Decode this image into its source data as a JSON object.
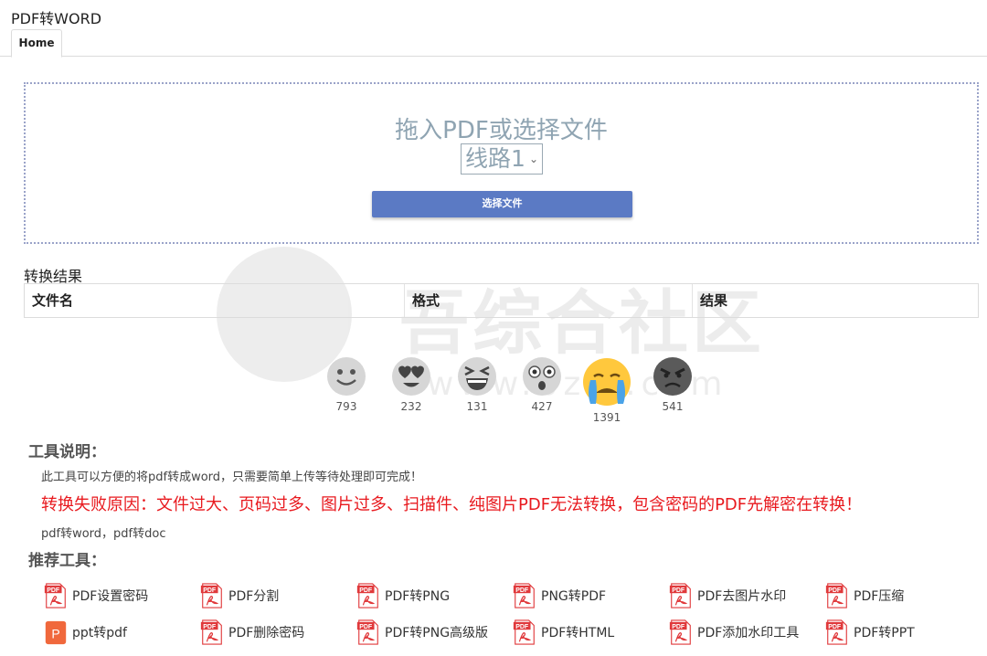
{
  "app": {
    "title": "PDF转WORD"
  },
  "tabs": [
    {
      "label": "Home"
    }
  ],
  "upload": {
    "prompt": "拖入PDF或选择文件",
    "route_selected": "线路1",
    "choose_button": "选择文件"
  },
  "results": {
    "label": "转换结果",
    "columns": [
      "文件名",
      "格式",
      "结果"
    ]
  },
  "reactions": [
    {
      "icon": "smile-face-icon",
      "count": "793"
    },
    {
      "icon": "heart-eyes-face-icon",
      "count": "232"
    },
    {
      "icon": "grinning-squint-face-icon",
      "count": "131"
    },
    {
      "icon": "astonished-face-icon",
      "count": "427"
    },
    {
      "icon": "crying-face-icon",
      "count": "1391"
    },
    {
      "icon": "angry-face-icon",
      "count": "541"
    }
  ],
  "tool_info": {
    "heading": "工具说明：",
    "description": "此工具可以方便的将pdf转成word，只需要简单上传等待处理即可完成！",
    "warning": "转换失败原因：文件过大、页码过多、图片过多、扫描件、纯图片PDF无法转换，包含密码的PDF先解密在转换！",
    "keywords": "pdf转word，pdf转doc"
  },
  "recommend": {
    "heading": "推荐工具：",
    "tools": [
      {
        "label": "PDF设置密码",
        "icon": "pdf-file-icon"
      },
      {
        "label": "PDF分割",
        "icon": "pdf-file-icon"
      },
      {
        "label": "PDF转PNG",
        "icon": "pdf-file-icon"
      },
      {
        "label": "PNG转PDF",
        "icon": "pdf-file-icon"
      },
      {
        "label": "PDF去图片水印",
        "icon": "pdf-file-icon"
      },
      {
        "label": "PDF压缩",
        "icon": "pdf-file-icon"
      },
      {
        "label": "ppt转pdf",
        "icon": "ppt-file-icon"
      },
      {
        "label": "PDF删除密码",
        "icon": "pdf-file-icon"
      },
      {
        "label": "PDF转PNG高级版",
        "icon": "pdf-file-icon"
      },
      {
        "label": "PDF转HTML",
        "icon": "pdf-file-icon"
      },
      {
        "label": "PDF添加水印工具",
        "icon": "pdf-file-icon"
      },
      {
        "label": "PDF转PPT",
        "icon": "pdf-file-icon"
      }
    ]
  },
  "watermark": {
    "text": "吾综合社区",
    "url": "www.bzkl.com"
  },
  "colors": {
    "accent": "#5b7ac4",
    "warning": "#e8191e",
    "prompt": "#8fa4b2",
    "pdf_red": "#e0393b",
    "ppt_orange": "#f0683c"
  }
}
